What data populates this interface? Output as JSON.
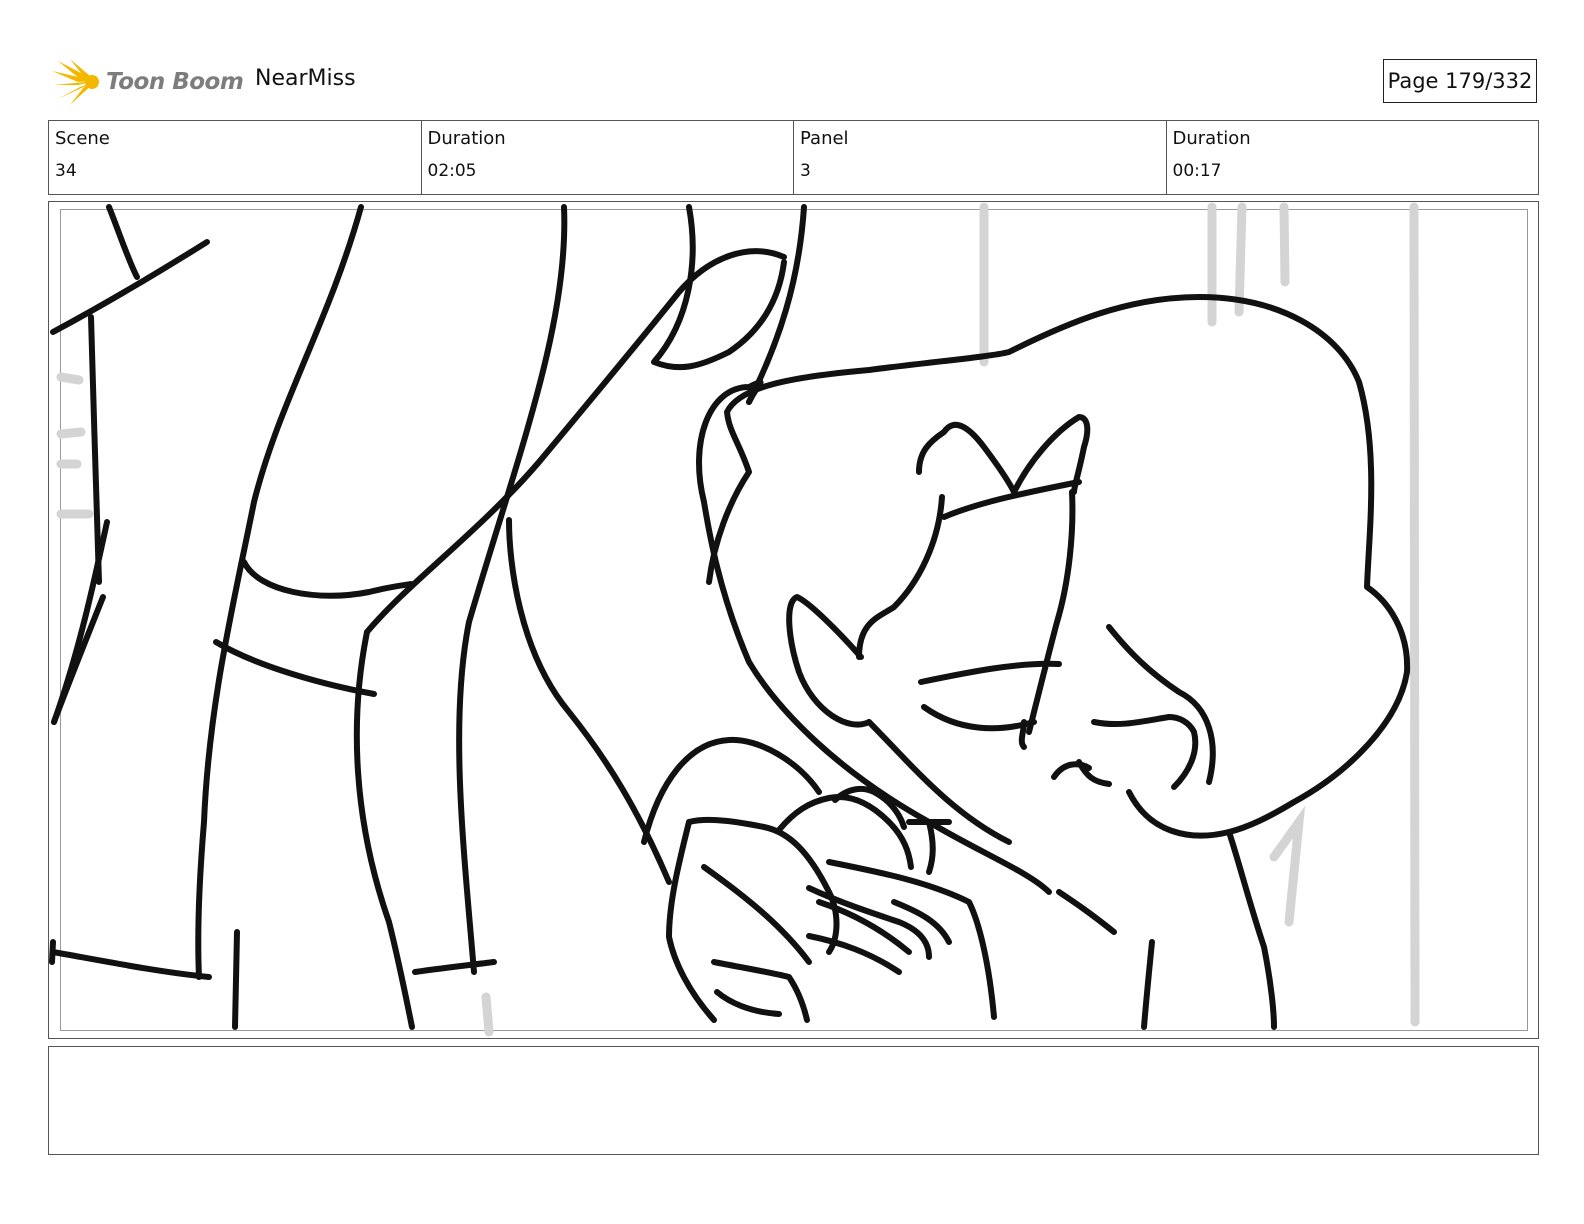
{
  "header": {
    "logo_text": "Toon Boom",
    "project_name": "NearMiss",
    "page_indicator": "Page 179/332"
  },
  "info": [
    {
      "label": "Scene",
      "value": "34"
    },
    {
      "label": "Duration",
      "value": "02:05"
    },
    {
      "label": "Panel",
      "value": "3"
    },
    {
      "label": "Duration",
      "value": "00:17"
    }
  ],
  "panel": {
    "image_description": "Rough line sketch of a woman with eyes closed leaning her head on a hand resting on her shoulder"
  },
  "notes": {
    "text": ""
  },
  "colors": {
    "logo_burst": "#f5b800",
    "logo_text": "#7d7d7d",
    "border": "#555555",
    "sketch_line": "#111111",
    "sketch_guide": "#d4d4d4"
  }
}
